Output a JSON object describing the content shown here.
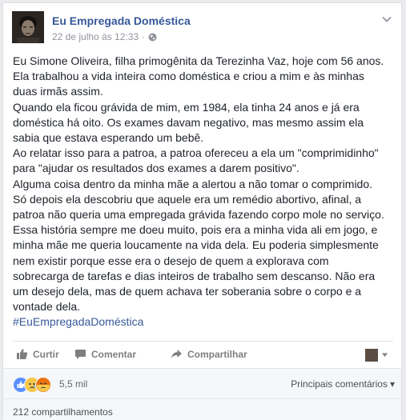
{
  "post": {
    "page_name": "Eu Empregada Doméstica",
    "timestamp": "22 de julho às 12:33",
    "separator": "·",
    "audience_icon": "globe-icon",
    "menu_icon": "chevron-down-icon",
    "lines": [
      "Eu Simone Oliveira, filha primogênita da Terezinha Vaz, hoje com 56 anos.",
      "Ela trabalhou a vida inteira como doméstica e criou a mim e às minhas",
      "duas irmãs assim.",
      "Quando ela ficou grávida de mim, em 1984, ela tinha 24 anos e já era",
      "doméstica há oito. Os exames davam negativo, mas mesmo assim ela",
      "sabia que estava esperando um bebê.",
      "Ao relatar isso para a patroa, a patroa ofereceu a ela um \"comprimidinho\"",
      "para \"ajudar os resultados dos exames a darem positivo\".",
      "Alguma coisa dentro da minha mãe a alertou a não tomar o comprimido.",
      "Só depois ela descobriu que aquele era um remédio abortivo, afinal, a",
      "patroa não queria uma empregada grávida fazendo corpo mole no serviço.",
      "Essa história sempre me doeu muito, pois era a minha vida ali em jogo, e",
      "minha mãe me queria loucamente na vida dela. Eu poderia simplesmente",
      "nem existir porque esse era o desejo de quem a explorava com",
      "sobrecarga de tarefas e dias inteiros de trabalho sem descanso. Não era",
      "um desejo dela, mas de quem achava ter soberania sobre o corpo e a",
      "vontade dela."
    ],
    "hashtag": "#EuEmpregadaDoméstica"
  },
  "actions": {
    "like": "Curtir",
    "comment": "Comentar",
    "share": "Compartilhar"
  },
  "reactions": {
    "icons": [
      "like-icon",
      "sad-icon",
      "angry-icon"
    ],
    "count": "5,5 mil",
    "sort_label": "Principais comentários",
    "sort_arrow": "▾"
  },
  "shares": {
    "count": "212 compartilhamentos"
  },
  "colors": {
    "link": "#365899",
    "text": "#1d2129",
    "muted": "#90949c",
    "like_blue": "#5890ff",
    "sad_yellow": "#f7c84a",
    "angry_red": "#e9710f"
  }
}
